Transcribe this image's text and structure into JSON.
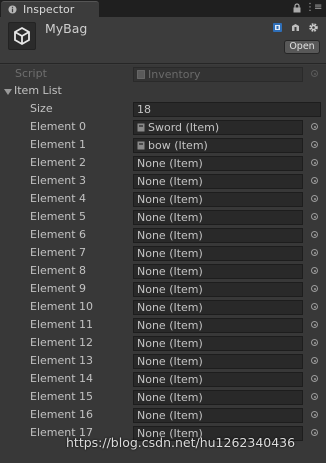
{
  "window": {
    "tab_label": "Inspector",
    "menu_glyph": "⋮≡"
  },
  "header": {
    "object_name": "MyBag",
    "open_label": "Open"
  },
  "script_row": {
    "label": "Script",
    "value": "Inventory"
  },
  "item_list": {
    "label": "Item List",
    "size_label": "Size",
    "size_value": "18",
    "elements": [
      {
        "label": "Element 0",
        "value": "Sword (Item)"
      },
      {
        "label": "Element 1",
        "value": "bow (Item)"
      },
      {
        "label": "Element 2",
        "value": "None (Item)"
      },
      {
        "label": "Element 3",
        "value": "None (Item)"
      },
      {
        "label": "Element 4",
        "value": "None (Item)"
      },
      {
        "label": "Element 5",
        "value": "None (Item)"
      },
      {
        "label": "Element 6",
        "value": "None (Item)"
      },
      {
        "label": "Element 7",
        "value": "None (Item)"
      },
      {
        "label": "Element 8",
        "value": "None (Item)"
      },
      {
        "label": "Element 9",
        "value": "None (Item)"
      },
      {
        "label": "Element 10",
        "value": "None (Item)"
      },
      {
        "label": "Element 11",
        "value": "None (Item)"
      },
      {
        "label": "Element 12",
        "value": "None (Item)"
      },
      {
        "label": "Element 13",
        "value": "None (Item)"
      },
      {
        "label": "Element 14",
        "value": "None (Item)"
      },
      {
        "label": "Element 15",
        "value": "None (Item)"
      },
      {
        "label": "Element 16",
        "value": "None (Item)"
      },
      {
        "label": "Element 17",
        "value": "None (Item)"
      }
    ]
  },
  "watermark": "https://blog.csdn.net/hu1262340436",
  "icons": {
    "tab": "info-icon",
    "lock": "lock-icon",
    "object": "unity-logo-icon",
    "help": "help-book-icon",
    "settings_small": "preset-icon",
    "settings": "gear-icon",
    "script_asset": "script-asset-icon",
    "item_asset": "scriptable-object-icon",
    "picker": "object-picker-icon"
  },
  "colors": {
    "background": "#383838",
    "header": "#3c3c3c",
    "field": "#292929",
    "text": "#c2c2c2",
    "dim_text": "#6e6e6e"
  }
}
